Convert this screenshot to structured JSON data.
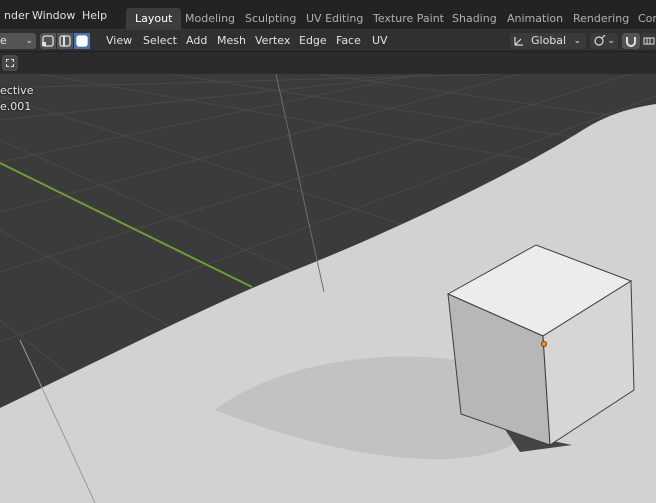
{
  "topbar": {
    "menus": [
      "nder",
      "Window",
      "Help"
    ],
    "workspaces": [
      {
        "label": "Layout",
        "active": true
      },
      {
        "label": "Modeling"
      },
      {
        "label": "Sculpting"
      },
      {
        "label": "UV Editing"
      },
      {
        "label": "Texture Paint"
      },
      {
        "label": "Shading"
      },
      {
        "label": "Animation"
      },
      {
        "label": "Rendering"
      },
      {
        "label": "Con"
      }
    ]
  },
  "header": {
    "mode_label": "e",
    "menus": [
      "View",
      "Select",
      "Add",
      "Mesh",
      "Vertex",
      "Edge",
      "Face",
      "UV"
    ],
    "orientation": "Global",
    "select_modes": [
      "vertex",
      "edge",
      "face"
    ],
    "active_select_mode": "face"
  },
  "overlay": {
    "view_label": "ective",
    "object_label": "e.001"
  },
  "colors": {
    "accent": "#4772b3",
    "grid_floor": "#3a3a3a",
    "plane": "#d4d4d4",
    "x_axis": "#6e9e2e",
    "vertex_selected": "#ff8a1f"
  }
}
